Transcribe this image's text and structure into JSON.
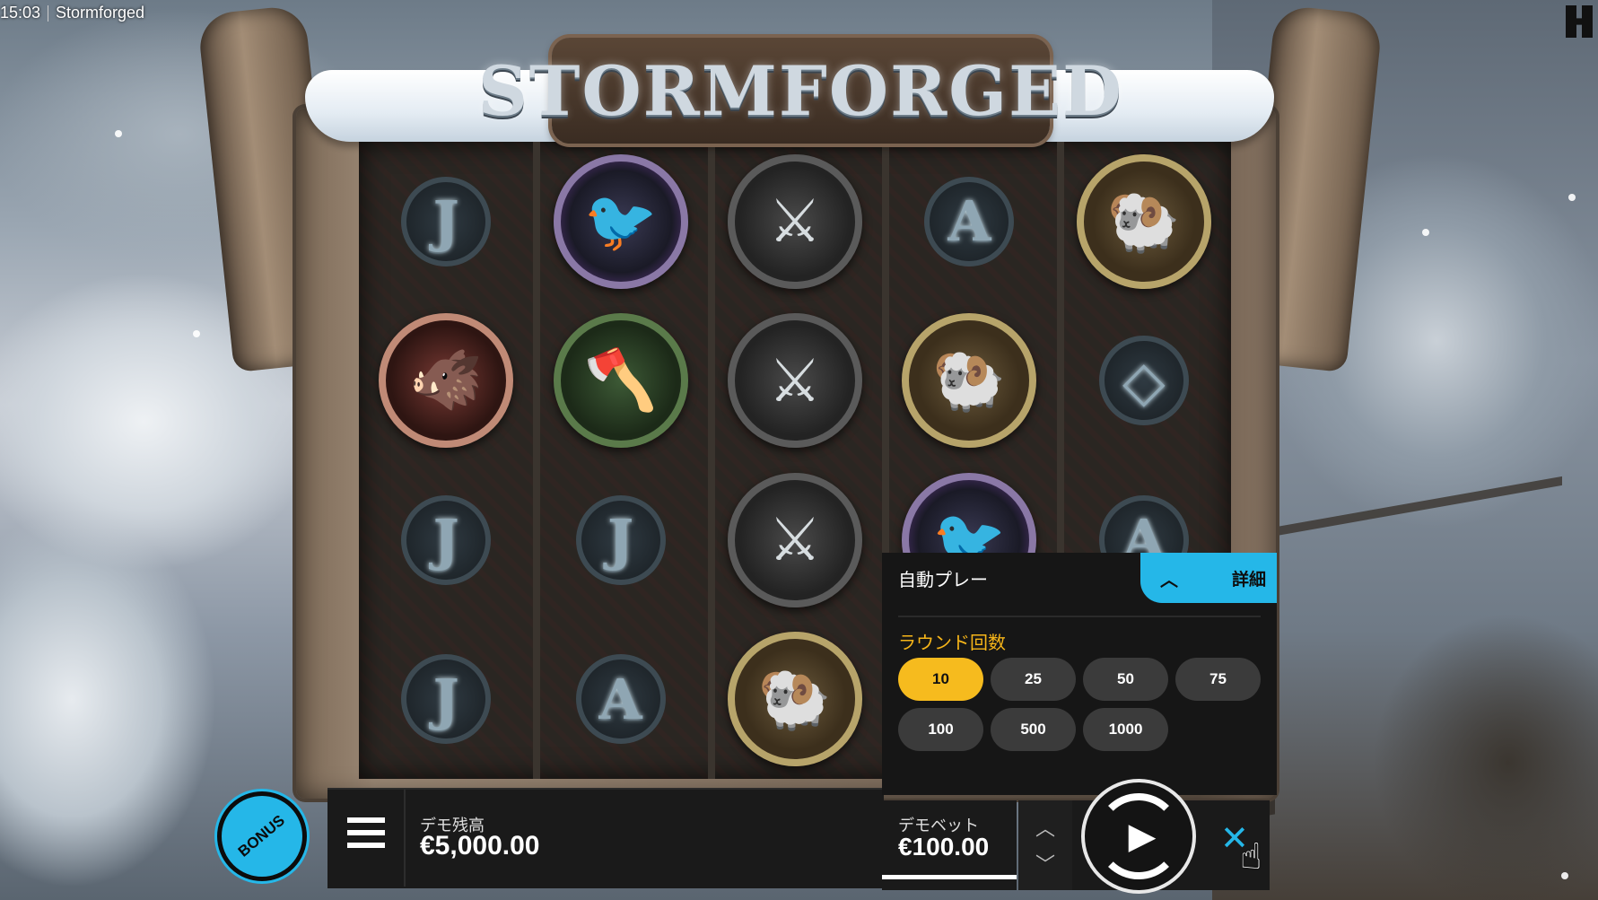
{
  "topbar": {
    "time": "15:03",
    "title": "Stormforged"
  },
  "game": {
    "logo": "STORMFORGED"
  },
  "reels": [
    [
      {
        "type": "letter",
        "label": "J"
      },
      {
        "type": "medal",
        "icon": "boar-icon",
        "class": "boar",
        "glyph": "🐗"
      },
      {
        "type": "letter",
        "label": "J"
      },
      {
        "type": "letter",
        "label": "J"
      }
    ],
    [
      {
        "type": "medal",
        "icon": "raven-icon",
        "class": "raven",
        "glyph": "🐦"
      },
      {
        "type": "medal",
        "icon": "axe-icon",
        "class": "axe",
        "glyph": "🪓"
      },
      {
        "type": "letter",
        "label": "J"
      },
      {
        "type": "letter",
        "label": "A"
      }
    ],
    [
      {
        "type": "medal",
        "icon": "crossed-swords-icon",
        "class": "swords",
        "glyph": "⚔"
      },
      {
        "type": "medal",
        "icon": "crossed-swords-icon",
        "class": "swords",
        "glyph": "⚔"
      },
      {
        "type": "medal",
        "icon": "crossed-swords-icon",
        "class": "swords",
        "glyph": "⚔"
      },
      {
        "type": "medal",
        "icon": "ram-icon",
        "class": "ram",
        "glyph": "🐏"
      }
    ],
    [
      {
        "type": "letter",
        "label": "A"
      },
      {
        "type": "medal",
        "icon": "ram-icon",
        "class": "ram",
        "glyph": "🐏"
      },
      {
        "type": "medal",
        "icon": "raven-icon",
        "class": "raven",
        "glyph": "🐦"
      },
      {
        "type": "empty"
      }
    ],
    [
      {
        "type": "medal",
        "icon": "ram-icon",
        "class": "ram",
        "glyph": "🐏"
      },
      {
        "type": "letter",
        "label": "◇"
      },
      {
        "type": "letter",
        "label": "A"
      },
      {
        "type": "empty"
      }
    ]
  ],
  "bonus": {
    "label": "BONUS"
  },
  "balance": {
    "label": "デモ残高",
    "value": "€5,000.00"
  },
  "autoplay": {
    "title": "自動プレー",
    "details_label": "詳細",
    "rounds_label": "ラウンド回数",
    "options": [
      "10",
      "25",
      "50",
      "75",
      "100",
      "500",
      "1000"
    ],
    "selected": "10"
  },
  "bet": {
    "label": "デモベット",
    "value": "€100.00"
  },
  "colors": {
    "accent": "#25b7e8",
    "selected": "#f6bb1e"
  }
}
